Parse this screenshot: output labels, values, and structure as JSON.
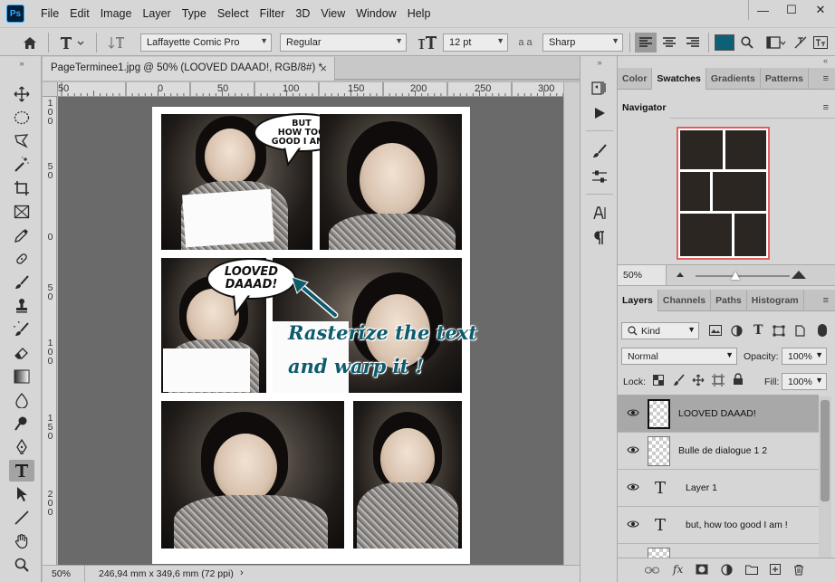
{
  "menu": {
    "logo": "Ps",
    "items": [
      "File",
      "Edit",
      "Image",
      "Layer",
      "Type",
      "Select",
      "Filter",
      "3D",
      "View",
      "Window",
      "Help"
    ],
    "window_controls": [
      "—",
      "☐",
      "✕"
    ]
  },
  "options_bar": {
    "font_family": "Laffayette Comic Pro",
    "font_style": "Regular",
    "font_size": "12 pt",
    "antialias_label": "a a",
    "antialias": "Sharp",
    "text_color": "#0e6077"
  },
  "document": {
    "tab_title": "PageTerminee1.jpg @ 50% (LOOVED DAAAD!, RGB/8#) *",
    "close": "×",
    "ruler_h": [
      "50",
      "0",
      "50",
      "100",
      "150",
      "200",
      "250",
      "300"
    ],
    "ruler_v": [
      [
        "1",
        "0",
        "0"
      ],
      [
        "5",
        "0"
      ],
      [
        "0"
      ],
      [
        "5",
        "0"
      ],
      [
        "1",
        "0",
        "0"
      ],
      [
        "1",
        "5",
        "0"
      ],
      [
        "2",
        "0",
        "0"
      ]
    ],
    "bubble1": [
      "BUT",
      "HOW TOO",
      "GOOD I AM !"
    ],
    "bubble2": [
      "LOOVED",
      "DAAAD!"
    ],
    "annotation": [
      "Rasterize the text",
      "and warp it !"
    ],
    "annotation_color": "#0d5c6e"
  },
  "status": {
    "zoom": "50%",
    "info": "246,94 mm x 349,6 mm (72 ppi)",
    "arrow": "›"
  },
  "panels": {
    "top_tabs": [
      "Color",
      "Swatches",
      "Gradients",
      "Patterns"
    ],
    "navigator_title": "Navigator",
    "navigator_zoom": "50%",
    "layer_tabs": [
      "Layers",
      "Channels",
      "Paths",
      "Histogram"
    ],
    "filter_kind": "Kind",
    "blend_mode": "Normal",
    "opacity_label": "Opacity:",
    "opacity": "100%",
    "lock_label": "Lock:",
    "fill_label": "Fill:",
    "fill": "100%",
    "layers": [
      {
        "name": "LOOVED DAAAD!",
        "kind": "raster",
        "selected": true
      },
      {
        "name": "Bulle de dialogue 1 2",
        "kind": "raster",
        "selected": false
      },
      {
        "name": "Layer 1",
        "kind": "text",
        "selected": false
      },
      {
        "name": "but, how too  good I am !",
        "kind": "text",
        "selected": false
      }
    ],
    "type_glyph": "T",
    "menu_glyph": "≡"
  }
}
